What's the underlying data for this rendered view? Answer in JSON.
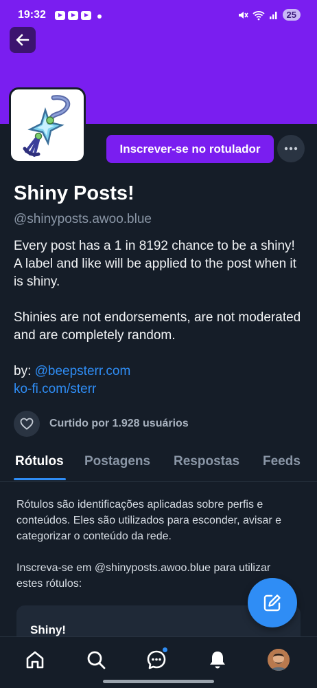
{
  "status_bar": {
    "time": "19:32",
    "battery": "25"
  },
  "profile": {
    "display_name": "Shiny Posts!",
    "handle": "@shinyposts.awoo.blue",
    "subscribe_label": "Inscrever-se no rotulador",
    "bio_paragraph_1": "Every post has a 1 in 8192 chance to be a shiny! A label and like will be applied to the post when it is shiny.",
    "bio_paragraph_2": "Shinies are not endorsements, are not moderated and are completely random.",
    "by_prefix": "by: ",
    "by_link": "@beepsterr.com",
    "kofi_link": "ko-fi.com/sterr",
    "liked_by": "Curtido por 1.928 usuários"
  },
  "tabs": [
    {
      "label": "Rótulos",
      "active": true
    },
    {
      "label": "Postagens",
      "active": false
    },
    {
      "label": "Respostas",
      "active": false
    },
    {
      "label": "Feeds",
      "active": false
    }
  ],
  "labels_info": {
    "description": "Rótulos são identificações aplicadas sobre perfis e conteúdos. Eles são utilizados para esconder, avisar e categorizar o conteúdo da rede.",
    "subscribe_hint": "Inscreva-se em @shinyposts.awoo.blue para utilizar estes rótulos:",
    "first_label": "Shiny!"
  },
  "icons": {
    "back": "arrow-left-icon",
    "more": "ellipsis-icon",
    "heart": "heart-icon",
    "compose": "compose-icon",
    "home": "home-icon",
    "search": "search-icon",
    "chat": "chat-icon",
    "notifications": "bell-icon"
  },
  "colors": {
    "accent": "#7a1ef0",
    "link": "#2f8df5",
    "background": "#151d28"
  }
}
